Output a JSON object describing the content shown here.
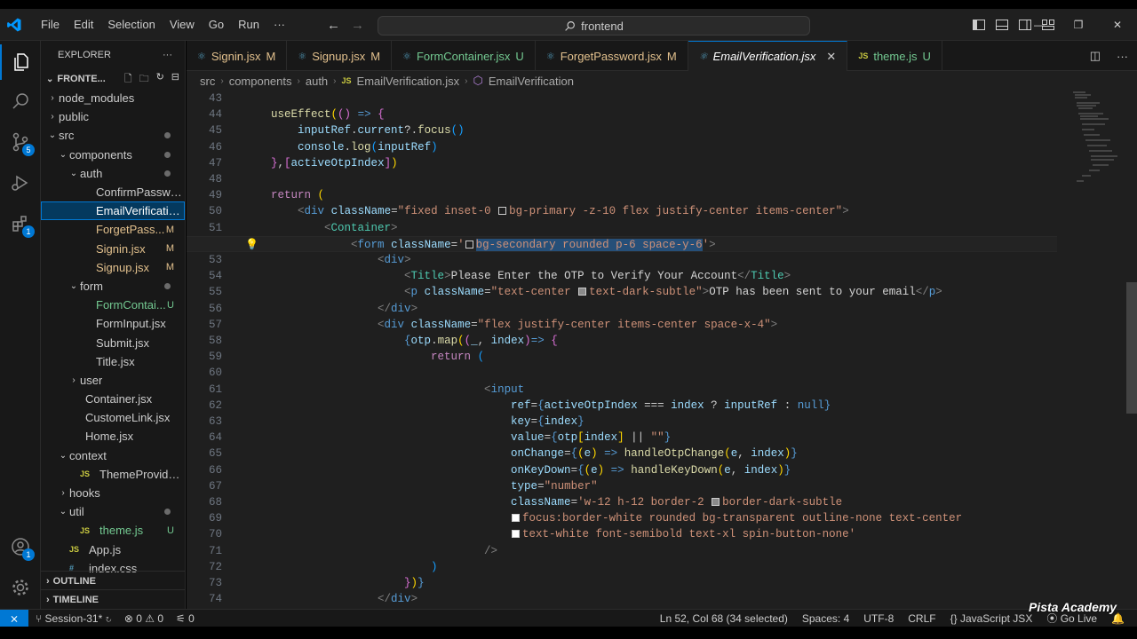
{
  "window": {
    "search": "frontend",
    "menu": [
      "File",
      "Edit",
      "Selection",
      "View",
      "Go",
      "Run",
      "···"
    ]
  },
  "explorer": {
    "title": "EXPLORER",
    "folder": "FRONTE...",
    "items": [
      {
        "label": "node_modules",
        "type": "folder",
        "state": "collapsed",
        "depth": 0
      },
      {
        "label": "public",
        "type": "folder",
        "state": "collapsed",
        "depth": 0
      },
      {
        "label": "src",
        "type": "folder",
        "state": "expanded",
        "depth": 0,
        "dot": true
      },
      {
        "label": "components",
        "type": "folder",
        "state": "expanded",
        "depth": 1,
        "dot": true
      },
      {
        "label": "auth",
        "type": "folder",
        "state": "expanded",
        "depth": 2,
        "dot": true
      },
      {
        "label": "ConfirmPassword...",
        "type": "file",
        "depth": 3
      },
      {
        "label": "EmailVerification.j...",
        "type": "file",
        "depth": 3,
        "selected": true
      },
      {
        "label": "ForgetPass...",
        "type": "file",
        "depth": 3,
        "status": "M"
      },
      {
        "label": "Signin.jsx",
        "type": "file",
        "depth": 3,
        "status": "M"
      },
      {
        "label": "Signup.jsx",
        "type": "file",
        "depth": 3,
        "status": "M"
      },
      {
        "label": "form",
        "type": "folder",
        "state": "expanded",
        "depth": 2,
        "dot": true
      },
      {
        "label": "FormContai...",
        "type": "file",
        "depth": 3,
        "status": "U"
      },
      {
        "label": "FormInput.jsx",
        "type": "file",
        "depth": 3
      },
      {
        "label": "Submit.jsx",
        "type": "file",
        "depth": 3
      },
      {
        "label": "Title.jsx",
        "type": "file",
        "depth": 3
      },
      {
        "label": "user",
        "type": "folder",
        "state": "collapsed",
        "depth": 2
      },
      {
        "label": "Container.jsx",
        "type": "file",
        "depth": 2
      },
      {
        "label": "CustomeLink.jsx",
        "type": "file",
        "depth": 2
      },
      {
        "label": "Home.jsx",
        "type": "file",
        "depth": 2
      },
      {
        "label": "context",
        "type": "folder",
        "state": "expanded",
        "depth": 1
      },
      {
        "label": "ThemeProvider.js",
        "type": "jsfile",
        "depth": 2
      },
      {
        "label": "hooks",
        "type": "folder",
        "state": "collapsed",
        "depth": 1
      },
      {
        "label": "util",
        "type": "folder",
        "state": "expanded",
        "depth": 1,
        "dot": true
      },
      {
        "label": "theme.js",
        "type": "jsfile",
        "depth": 2,
        "status": "U"
      },
      {
        "label": "App.js",
        "type": "jsfile",
        "depth": 1
      },
      {
        "label": "index.css",
        "type": "cssfile",
        "depth": 1
      }
    ],
    "outline": "OUTLINE",
    "timeline": "TIMELINE"
  },
  "tabs": [
    {
      "label": "Signin.jsx",
      "status": "M"
    },
    {
      "label": "Signup.jsx",
      "status": "M"
    },
    {
      "label": "FormContainer.jsx",
      "status": "U"
    },
    {
      "label": "ForgetPassword.jsx",
      "status": "M"
    },
    {
      "label": "EmailVerification.jsx",
      "status": "",
      "active": true
    },
    {
      "label": "theme.js",
      "status": "U",
      "js": true
    }
  ],
  "breadcrumb": [
    "src",
    "components",
    "auth",
    "EmailVerification.jsx",
    "EmailVerification"
  ],
  "editor": {
    "current_line": 52,
    "lines": [
      43,
      44,
      45,
      46,
      47,
      48,
      49,
      50,
      51,
      52,
      53,
      54,
      55,
      56,
      57,
      58,
      59,
      60,
      61,
      62,
      63,
      64,
      65,
      66,
      67,
      68,
      69,
      70,
      71,
      72,
      73,
      74
    ]
  },
  "statusbar": {
    "session": "Session-31*",
    "errors": "0",
    "warnings": "0",
    "ports": "0",
    "position": "Ln 52, Col 68 (34 selected)",
    "spaces": "Spaces: 4",
    "encoding": "UTF-8",
    "eol": "CRLF",
    "language": "JavaScript JSX",
    "golive": "Go Live"
  },
  "watermark": "Pista Academy",
  "colors": {
    "accent": "#0078d4",
    "modified": "#e2c08d",
    "untracked": "#73c991",
    "editor_bg": "#1f1f1f"
  }
}
